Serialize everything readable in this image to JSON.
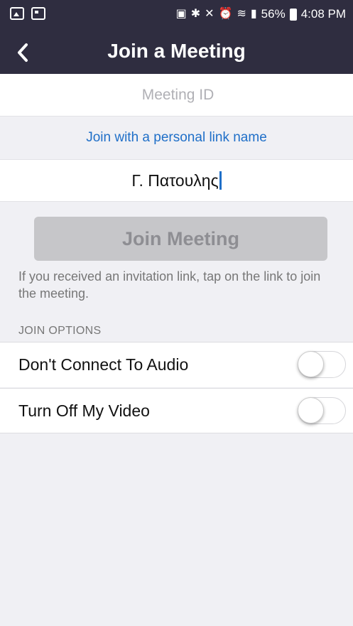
{
  "status_bar": {
    "battery": "56%",
    "time": "4:08 PM"
  },
  "header": {
    "title": "Join a Meeting"
  },
  "form": {
    "meeting_id_placeholder": "Meeting ID",
    "meeting_id_value": "",
    "personal_link_label": "Join with a personal link name",
    "name_value": "Γ. Πατουλης",
    "join_button_label": "Join Meeting",
    "join_button_enabled": false,
    "info_text": "If you received an invitation link, tap on the link to join the meeting."
  },
  "options": {
    "section_label": "JOIN OPTIONS",
    "items": [
      {
        "label": "Don't Connect To Audio",
        "enabled": false
      },
      {
        "label": "Turn Off My Video",
        "enabled": false
      }
    ]
  },
  "colors": {
    "header_bg": "#2f2d40",
    "link": "#1f6fc8",
    "button_disabled_bg": "#c6c6c9",
    "button_disabled_text": "#8e8e93",
    "page_bg": "#f0f0f4"
  },
  "icons": {
    "status_left": [
      "gallery-icon",
      "calendar-icon"
    ],
    "status_right": [
      "sim-icon",
      "bluetooth-icon",
      "mute-icon",
      "alarm-icon",
      "wifi-icon",
      "signal-icon",
      "battery-icon"
    ],
    "back": "chevron-left-icon"
  }
}
